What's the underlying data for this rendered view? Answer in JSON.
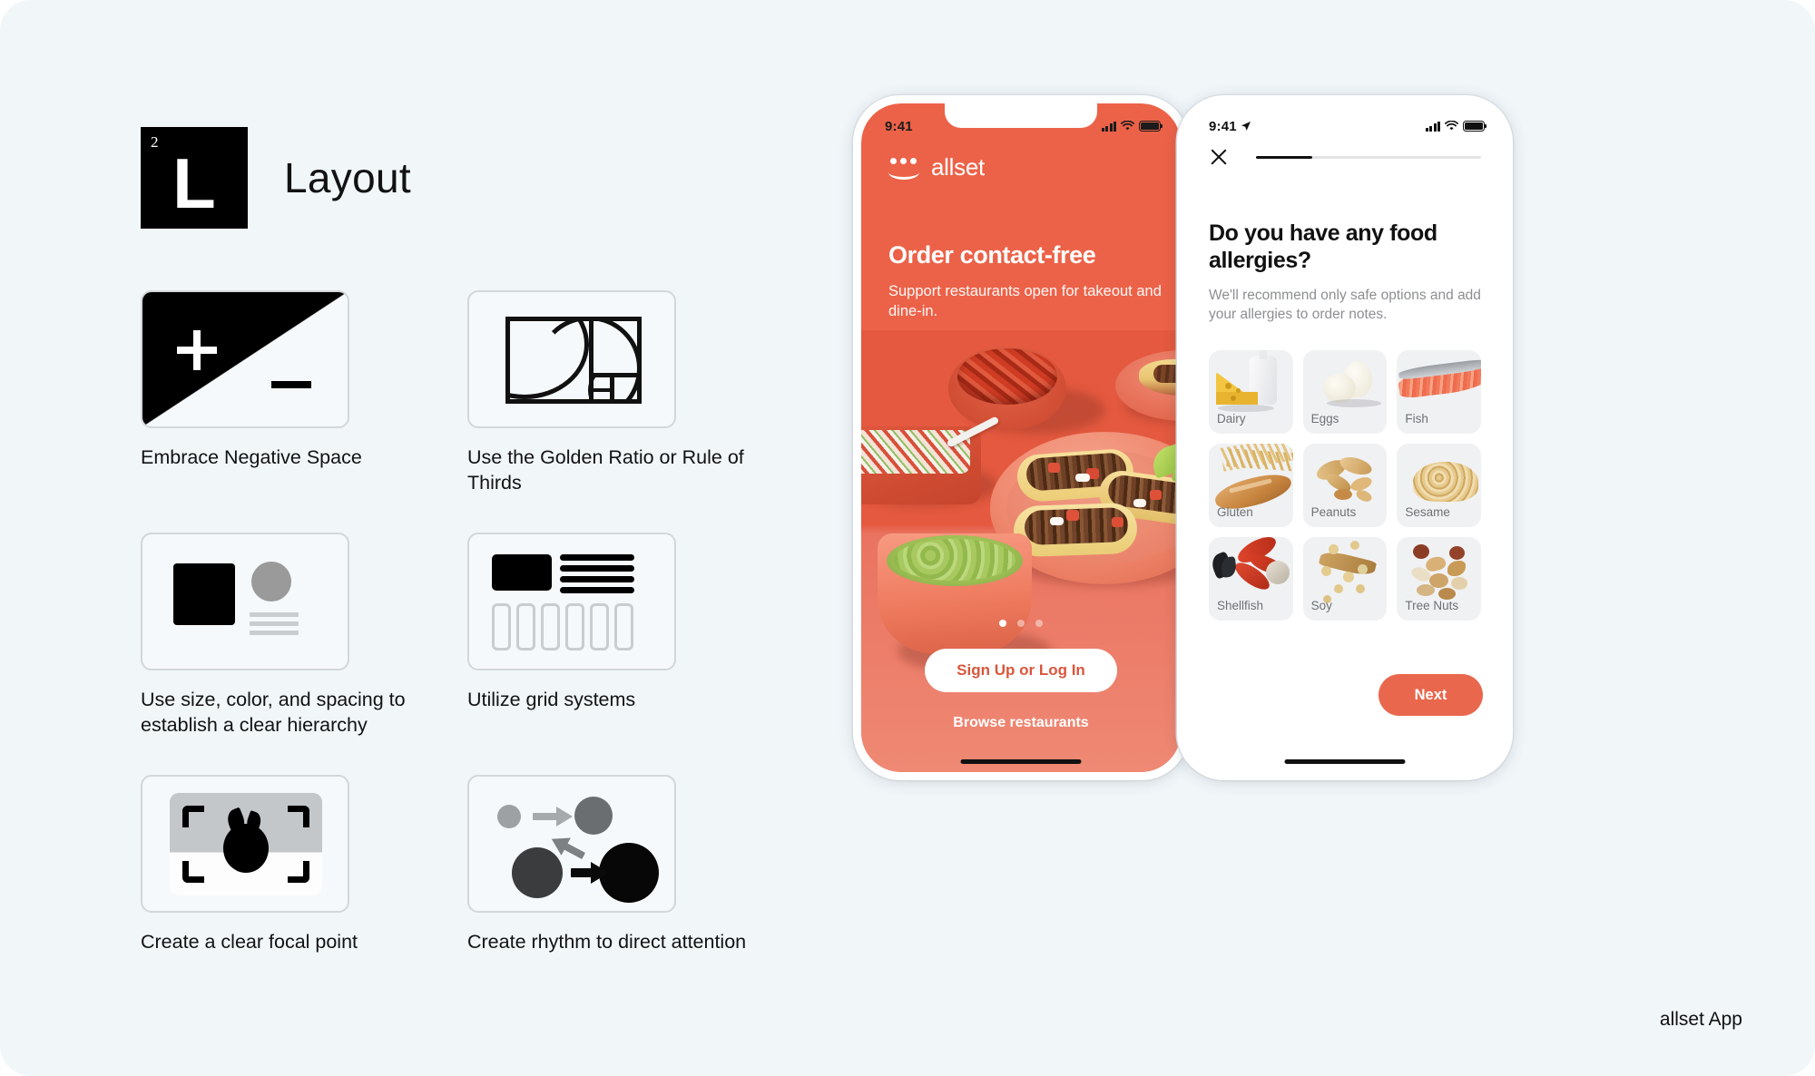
{
  "section": {
    "badge_number": "2",
    "badge_letter": "L",
    "title": "Layout"
  },
  "principles": [
    {
      "icon": "negative-space-icon",
      "label": "Embrace Negative Space"
    },
    {
      "icon": "golden-ratio-icon",
      "label": "Use the Golden Ratio or Rule of Thirds"
    },
    {
      "icon": "hierarchy-icon",
      "label": "Use size, color, and spacing to establish a clear hierarchy"
    },
    {
      "icon": "grid-system-icon",
      "label": "Utilize grid systems"
    },
    {
      "icon": "focal-point-icon",
      "label": "Create a clear focal point"
    },
    {
      "icon": "rhythm-icon",
      "label": "Create rhythm to direct attention"
    }
  ],
  "phone1": {
    "status": {
      "time": "9:41",
      "signal_icon": "cellular-signal-icon",
      "wifi_icon": "wifi-icon",
      "battery_icon": "battery-icon"
    },
    "brand": {
      "name": "allset",
      "logo_icon": "allset-smile-logo-icon"
    },
    "hero": {
      "title": "Order contact-free",
      "subtitle": "Support restaurants open for takeout and dine-in."
    },
    "pagination": {
      "count": 3,
      "active_index": 0
    },
    "primary_cta": "Sign Up or Log In",
    "secondary_cta": "Browse restaurants"
  },
  "phone2": {
    "status": {
      "time": "9:41",
      "location_icon": "location-arrow-icon",
      "signal_icon": "cellular-signal-icon",
      "wifi_icon": "wifi-icon",
      "battery_icon": "battery-icon"
    },
    "close_icon": "close-x-icon",
    "progress_percent": 25,
    "question": "Do you have any  food allergies?",
    "description": "We'll recommend only safe options and add your allergies to order notes.",
    "allergies": [
      {
        "label": "Dairy",
        "icon": "cheese-milk-icon"
      },
      {
        "label": "Eggs",
        "icon": "eggs-icon"
      },
      {
        "label": "Fish",
        "icon": "salmon-fillet-icon"
      },
      {
        "label": "Gluten",
        "icon": "wheat-bread-icon"
      },
      {
        "label": "Peanuts",
        "icon": "peanuts-icon"
      },
      {
        "label": "Sesame",
        "icon": "sesame-seeds-icon"
      },
      {
        "label": "Shellfish",
        "icon": "lobster-shellfish-icon"
      },
      {
        "label": "Soy",
        "icon": "soybeans-icon"
      },
      {
        "label": "Tree Nuts",
        "icon": "mixed-nuts-icon"
      }
    ],
    "next_label": "Next"
  },
  "caption": "allset App",
  "colors": {
    "background": "#f1f6f9",
    "brand_orange": "#ec6248",
    "cta_orange": "#e9674c",
    "cta_text_orange": "#d9563c",
    "ink": "#111111",
    "muted": "#8c8f93",
    "card_grey": "#f0f1f3"
  }
}
